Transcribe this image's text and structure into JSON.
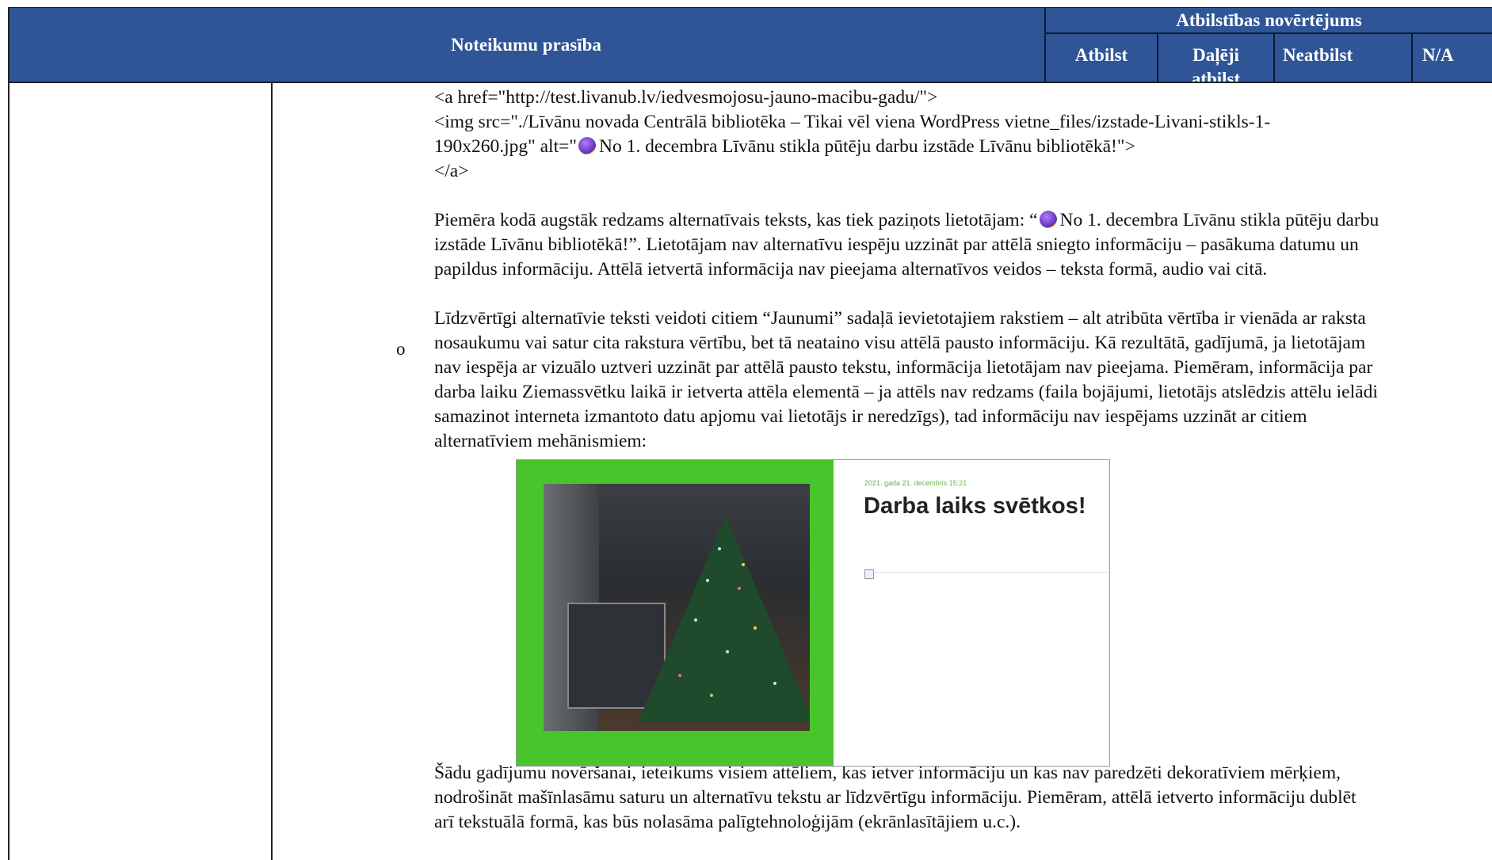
{
  "header": {
    "requirement": "Noteikumu prasība",
    "assessment_group": "Atbilstības novērtējums",
    "col_comply": "Atbilst",
    "col_partial_line1": "Daļēji",
    "col_partial_line2": "atbilst",
    "col_noncomply": "Neatbilst",
    "col_na": "N/A"
  },
  "code": {
    "line1": "<a href=\"http://test.livanub.lv/iedvesmojosu-jauno-macibu-gadu/\">",
    "line2": "<img src=\"./Līvānu novada Centrālā bibliotēka – Tikai vēl viena WordPress vietne_files/izstade-Livani-stikls-1-",
    "line3a": "190x260.jpg\" alt=\"",
    "line3b": "No 1. decembra Līvānu stikla pūtēju darbu izstāde Līvānu bibliotēkā!\">",
    "line4": "</a>"
  },
  "para1": {
    "l1a": "Piemēra kodā augstāk redzams alternatīvais teksts, kas tiek paziņots lietotājam: “",
    "l1b": "No 1. decembra Līvānu stikla pūtēju darbu",
    "l2": "izstāde Līvānu bibliotēkā!”. Lietotājam nav alternatīvu iespēju uzzināt par attēlā sniegto informāciju – pasākuma datumu un",
    "l3": "papildus informāciju. Attēlā ietvertā informācija nav pieejama alternatīvos veidos – teksta formā, audio vai citā."
  },
  "bullet_symbol": "o",
  "para2": {
    "l1": "Līdzvērtīgi alternatīvie teksti veidoti citiem “Jaunumi” sadaļā ievietotajiem rakstiem – alt atribūta vērtība ir vienāda ar raksta",
    "l2": "nosaukumu vai satur cita rakstura vērtību, bet tā neataino visu attēlā pausto informāciju. Kā rezultātā, gadījumā, ja lietotājam",
    "l3": "nav iespēja ar vizuālo uztveri uzzināt par attēlā pausto tekstu, informācija lietotājam nav pieejama. Piemēram, informācija par",
    "l4": "darba laiku Ziemassvētku laikā ir ietverta attēla elementā – ja attēls nav redzams (faila bojājumi, lietotājs atslēdzis attēlu ielādi",
    "l5": "samazinot interneta izmantoto datu apjomu vai lietotājs ir neredzīgs), tad informāciju nav iespējams uzzināt ar citiem",
    "l6": "alternatīviem mehānismiem:"
  },
  "screenshot": {
    "date": "2021. gada 21. decembris 15:21",
    "title": "Darba laiks svētkos!",
    "green_color": "#47c52b"
  },
  "para3": {
    "l1": "Šādu gadījumu novēršanai, ieteikums visiem attēliem, kas ietver informāciju un kas nav paredzēti dekoratīviem mērķiem,",
    "l2": "nodrošināt mašīnlasāmu saturu un alternatīvu tekstu ar līdzvērtīgu informāciju. Piemēram, attēlā ietverto informāciju dublēt",
    "l3": "arī tekstuālā formā, kas būs nolasāma palīgtehnoloģijām (ekrānlasītājiem u.c.)."
  }
}
